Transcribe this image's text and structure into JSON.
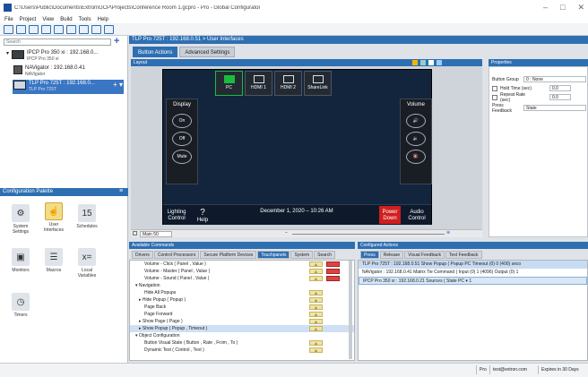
{
  "window": {
    "title": "C:\\Users\\Public\\Documents\\Extron\\GCP\\Projects\\Conference Room 1.gcpro - Pro - Global Configurator",
    "minimize": "–",
    "maximize": "□",
    "close": "✕"
  },
  "menu": [
    "File",
    "Project",
    "View",
    "Build",
    "Tools",
    "Help"
  ],
  "tree": {
    "search_placeholder": "Search",
    "add": "+",
    "items": [
      {
        "line1": "IPCP Pro 350 xi : 192.168.0...",
        "line2": "IPCP Pro 350 xi"
      },
      {
        "line1": "NAVigator : 192.168.0.41",
        "line2": "NAVigator"
      },
      {
        "line1": "TLP Pro 725T : 192.168.0...",
        "line2": "TLP Pro 725T"
      }
    ]
  },
  "palette": {
    "title": "Configuration Palette",
    "items": [
      {
        "label": "System Settings",
        "icon": "gear-icon"
      },
      {
        "label": "User Interfaces",
        "icon": "touch-icon"
      },
      {
        "label": "Schedules",
        "icon": "calendar-icon"
      },
      {
        "label": "Monitors",
        "icon": "monitor-icon"
      },
      {
        "label": "Macros",
        "icon": "list-icon"
      },
      {
        "label": "Local Variables",
        "icon": "variable-icon"
      },
      {
        "label": "Timers",
        "icon": "timer-icon"
      }
    ],
    "calendar_day": "15"
  },
  "center": {
    "breadcrumb": "TLP Pro 725T : 192.168.0.51 > User Interfaces",
    "tabs": [
      "Button Actions",
      "Advanced Settings"
    ],
    "layout_title": "Layout",
    "sources": [
      "PC",
      "HDMI 1",
      "HDMI 2",
      "ShareLink"
    ],
    "display_title": "Display",
    "display_buttons": [
      "On",
      "Off",
      "Mute"
    ],
    "volume_title": "Volume",
    "bottom": {
      "lighting": "Lighting Control",
      "help": "Help",
      "date": "December 1, 2020 – 10:26 AM",
      "power": "Power Down",
      "audio": "Audio Control"
    },
    "page_select": "Main 50",
    "zoom_icon": "−"
  },
  "properties": {
    "title": "Properties",
    "rows": [
      {
        "label": "Button Group",
        "value": "0 : None"
      },
      {
        "label": "Hold Time (sec)",
        "value": "0.0"
      },
      {
        "label": "Repeat Rate (sec)",
        "value": "0.0"
      },
      {
        "label": "Press Feedback",
        "value": "State"
      }
    ]
  },
  "commands": {
    "title": "Available Commands",
    "tabs": [
      "Drivers",
      "Control Processors",
      "Secure Platform Devices",
      "Touchpanels",
      "System",
      "Search"
    ],
    "active_tab": 3,
    "rows": [
      {
        "text": "Volume - Click ( Panel , Value )",
        "indent": 16
      },
      {
        "text": "Volume - Master ( Panel , Value )",
        "indent": 16
      },
      {
        "text": "Volume - Sound ( Panel , Value )",
        "indent": 16
      },
      {
        "text": "▾  Navigation",
        "indent": 6
      },
      {
        "text": "Hide All Popups",
        "indent": 16
      },
      {
        "text": "▸  Hide Popup ( Popup )",
        "indent": 10
      },
      {
        "text": "Page Back",
        "indent": 16
      },
      {
        "text": "Page Forward",
        "indent": 16
      },
      {
        "text": "▸  Show Page ( Page )",
        "indent": 10
      },
      {
        "text": "▸  Show Popup ( Popup , Timeout )",
        "indent": 10
      },
      {
        "text": "▾  Object Configuration",
        "indent": 6
      },
      {
        "text": "Button Visual State ( Button , Rate , From , To )",
        "indent": 16
      },
      {
        "text": "Dynamic Text ( Control , Text )",
        "indent": 16
      }
    ],
    "button_label": "A"
  },
  "configured": {
    "title": "Configured Actions",
    "tabs": [
      "Press",
      "Release",
      "Visual Feedback",
      "Text Feedback"
    ],
    "rows": [
      "TLP Pro 725T : 192.168.0.51 Show Popup ( Popup   PC      Timeout (0)   0     (400) seco",
      "NAVigator : 192.168.0.41 Matrix Tie Command ( Input (0)   1    (4096)  Output (0)   1",
      "IPCP Pro 350 xi : 192.168.0.21 Sources ( State   PC   ▾   1"
    ]
  },
  "status": {
    "level": "Pro",
    "email": "test@extron.com",
    "expiry": "Expires in 30 Days"
  }
}
